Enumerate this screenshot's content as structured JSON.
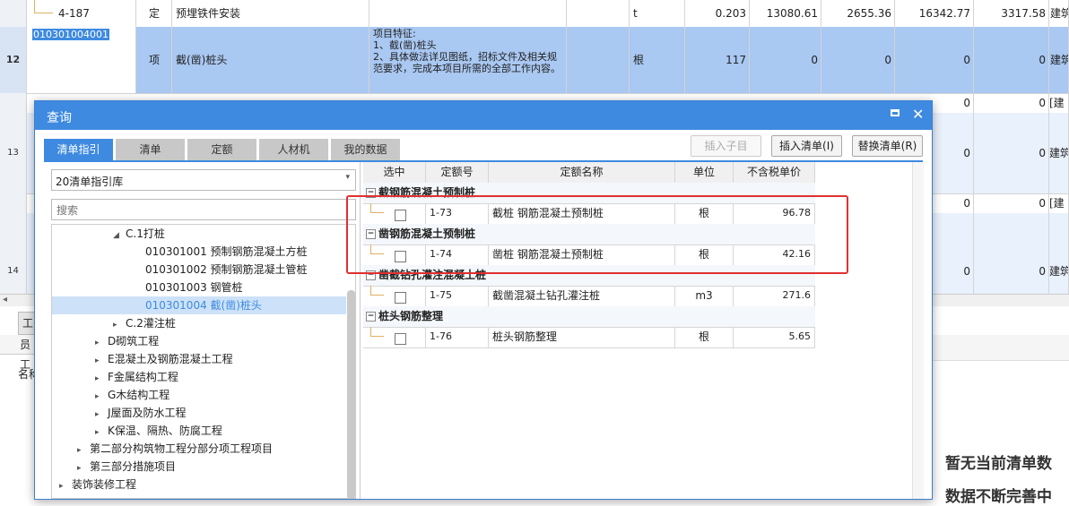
{
  "background": {
    "rows": [
      {
        "num": "",
        "code": "4-187",
        "type": "定",
        "name": "预埋铁件安装",
        "feature": "",
        "unit": "t",
        "qty": "0.203",
        "c1": "13080.61",
        "c2": "2655.36",
        "c3": "16342.77",
        "c4": "3317.58",
        "spec": "建筑"
      },
      {
        "num": "12",
        "code": "010301004001",
        "type": "项",
        "name": "截(凿)桩头",
        "feature": "项目特征:\n1、截(凿)桩头\n2、具体做法详见图纸，招标文件及相关规范要求，完成本项目所需的全部工作内容。",
        "unit": "根",
        "qty": "117",
        "c1": "0",
        "c2": "0",
        "c3": "0",
        "c4": "0",
        "spec": "建筑"
      }
    ],
    "right_rows": [
      {
        "num": "",
        "c3": "0",
        "c4": "0",
        "spec": "[建"
      },
      {
        "num": "13",
        "c3": "0",
        "c4": "0",
        "spec": "建筑"
      },
      {
        "num": "",
        "c3": "0",
        "c4": "0",
        "spec": "[建"
      },
      {
        "num": "14",
        "c3": "0",
        "c4": "0",
        "spec": "建筑"
      }
    ],
    "bottom_tab_fragment": "工",
    "bottom_label_1": "员工",
    "bottom_label_2": "名称",
    "empty_msg_1": "暂无当前清单数",
    "empty_msg_2": "数据不断完善中"
  },
  "dialog": {
    "title": "查询",
    "tabs": [
      "清单指引",
      "清单",
      "定额",
      "人材机",
      "我的数据"
    ],
    "active_tab": 0,
    "buttons": {
      "insert_child": "插入子目",
      "insert_list": "插入清单(I)",
      "replace_list": "替换清单(R)"
    },
    "library_select": "20清单指引库",
    "search_placeholder": "搜索",
    "tree": [
      {
        "label": "C.1打桩",
        "level": 3,
        "expanded": true
      },
      {
        "label": "010301001  预制钢筋混凝土方桩",
        "level": 4
      },
      {
        "label": "010301002  预制钢筋混凝土管桩",
        "level": 4
      },
      {
        "label": "010301003  钢管桩",
        "level": 4
      },
      {
        "label": "010301004  截(凿)桩头",
        "level": 4,
        "selected": true
      },
      {
        "label": "C.2灌注桩",
        "level": 3,
        "expanded": false
      },
      {
        "label": "D砌筑工程",
        "level": 2
      },
      {
        "label": "E混凝土及钢筋混凝土工程",
        "level": 2
      },
      {
        "label": "F金属结构工程",
        "level": 2
      },
      {
        "label": "G木结构工程",
        "level": 2
      },
      {
        "label": "J屋面及防水工程",
        "level": 2
      },
      {
        "label": "K保温、隔热、防腐工程",
        "level": 2
      },
      {
        "label": "第二部分构筑物工程分部分项工程项目",
        "level": 1
      },
      {
        "label": "第三部分措施项目",
        "level": 1
      },
      {
        "label": "装饰装修工程",
        "level": 0
      }
    ],
    "grid": {
      "headers": [
        "选中",
        "定额号",
        "定额名称",
        "单位",
        "不含税单价"
      ],
      "groups": [
        {
          "title": "截钢筋混凝土预制桩",
          "rows": [
            {
              "code": "1-73",
              "name": "截桩 钢筋混凝土预制桩",
              "unit": "根",
              "price": "96.78"
            }
          ]
        },
        {
          "title": "凿钢筋混凝土预制桩",
          "rows": [
            {
              "code": "1-74",
              "name": "凿桩 钢筋混凝土预制桩",
              "unit": "根",
              "price": "42.16"
            }
          ]
        },
        {
          "title": "凿截钻孔灌注混凝土桩",
          "rows": [
            {
              "code": "1-75",
              "name": "截凿混凝土钻孔灌注桩",
              "unit": "m3",
              "price": "271.6"
            }
          ]
        },
        {
          "title": "桩头钢筋整理",
          "rows": [
            {
              "code": "1-76",
              "name": "桩头钢筋整理",
              "unit": "根",
              "price": "5.65"
            }
          ]
        }
      ]
    }
  },
  "colors": {
    "accent": "#3e8ae0",
    "selected_row": "#a9c8f2",
    "highlight_box": "#e03030"
  }
}
